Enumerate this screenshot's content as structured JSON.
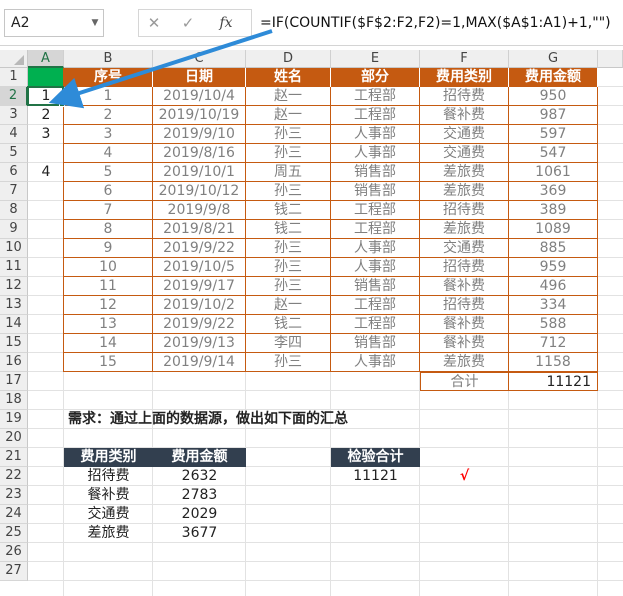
{
  "formula_bar": {
    "name_box": "A2",
    "cancel_symbol": "✕",
    "enter_symbol": "✓",
    "fx_label": "fx",
    "formula": "=IF(COUNTIF($F$2:F2,F2)=1,MAX($A$1:A1)+1,\"\")"
  },
  "columns": [
    "A",
    "B",
    "C",
    "D",
    "E",
    "F",
    "G"
  ],
  "rows": [
    "1",
    "2",
    "3",
    "4",
    "5",
    "6",
    "7",
    "8",
    "9",
    "10",
    "11",
    "12",
    "13",
    "14",
    "15",
    "16",
    "17",
    "18",
    "19",
    "20",
    "21",
    "22",
    "23",
    "24",
    "25",
    "26",
    "27"
  ],
  "table": {
    "headers": [
      "序号",
      "日期",
      "姓名",
      "部分",
      "费用类别",
      "费用金额"
    ],
    "rows": [
      [
        "1",
        "2019/10/4",
        "赵一",
        "工程部",
        "招待费",
        "950"
      ],
      [
        "2",
        "2019/10/19",
        "赵一",
        "工程部",
        "餐补费",
        "987"
      ],
      [
        "3",
        "2019/9/10",
        "孙三",
        "人事部",
        "交通费",
        "597"
      ],
      [
        "4",
        "2019/8/16",
        "孙三",
        "人事部",
        "交通费",
        "547"
      ],
      [
        "5",
        "2019/10/1",
        "周五",
        "销售部",
        "差旅费",
        "1061"
      ],
      [
        "6",
        "2019/10/12",
        "孙三",
        "销售部",
        "差旅费",
        "369"
      ],
      [
        "7",
        "2019/9/8",
        "钱二",
        "工程部",
        "招待费",
        "389"
      ],
      [
        "8",
        "2019/8/21",
        "钱二",
        "工程部",
        "差旅费",
        "1089"
      ],
      [
        "9",
        "2019/9/22",
        "孙三",
        "人事部",
        "交通费",
        "885"
      ],
      [
        "10",
        "2019/10/5",
        "孙三",
        "人事部",
        "招待费",
        "959"
      ],
      [
        "11",
        "2019/9/17",
        "孙三",
        "销售部",
        "餐补费",
        "496"
      ],
      [
        "12",
        "2019/10/2",
        "赵一",
        "工程部",
        "招待费",
        "334"
      ],
      [
        "13",
        "2019/9/22",
        "钱二",
        "工程部",
        "餐补费",
        "588"
      ],
      [
        "14",
        "2019/9/13",
        "李四",
        "销售部",
        "餐补费",
        "712"
      ],
      [
        "15",
        "2019/9/14",
        "孙三",
        "人事部",
        "差旅费",
        "1158"
      ]
    ],
    "total_label": "合计",
    "total_value": "11121"
  },
  "helper_column": [
    "1",
    "2",
    "3",
    "",
    "4"
  ],
  "requirement": "需求：通过上面的数据源，做出如下面的汇总",
  "summary": {
    "headers": [
      "费用类别",
      "费用金额"
    ],
    "rows": [
      [
        "招待费",
        "2632"
      ],
      [
        "餐补费",
        "2783"
      ],
      [
        "交通费",
        "2029"
      ],
      [
        "差旅费",
        "3677"
      ]
    ]
  },
  "check": {
    "header": "检验合计",
    "value": "11121",
    "mark": "√"
  },
  "colors": {
    "accent_orange": "#c55a11",
    "accent_navy": "#323f4f",
    "fill_green": "#00b050",
    "arrow_blue": "#2e8bd8",
    "check_red": "#ff0000",
    "selection_green": "#217346"
  }
}
